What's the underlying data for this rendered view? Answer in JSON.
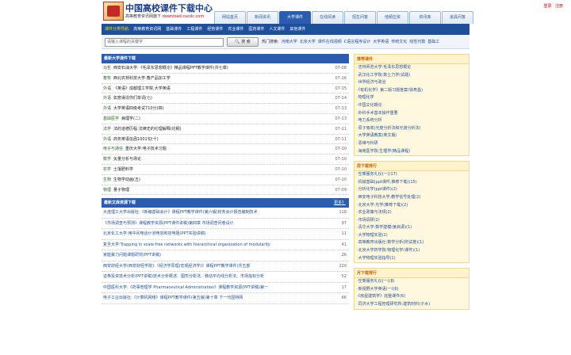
{
  "site": {
    "title": "中国高校课件下载中心",
    "subtitle": "高等教育资讯网旗下",
    "url": "download.cucdc.com"
  },
  "top_links": [
    "登录",
    "注册"
  ],
  "nav": {
    "tabs": [
      "网站首页",
      "新闻资讯",
      "大学课件",
      "在线阅读",
      "招生问答",
      "他频应资",
      "资讯库",
      "道具问答"
    ],
    "active_index": 2
  },
  "subnav": {
    "label": "课件分类导航:",
    "items": [
      "高等教育资讯网",
      "基础课件",
      "工程课件",
      "经管课件",
      "农业课件",
      "医药课件",
      "人文课件",
      "其他课件"
    ]
  },
  "search": {
    "placeholder": "请输入课程的关键字",
    "button": "搜 索",
    "hot_label": "热门搜索:",
    "hot_items": [
      "河南大学",
      "北京大学",
      "课件在线视频",
      "C语言程序设计",
      "大学英语",
      "传统文化",
      "线性代数",
      "基础工"
    ]
  },
  "course_section": {
    "title": "最新大学课件下载",
    "rows": [
      {
        "subject": "马哲",
        "title": "西安石油大学:《毛泽东思想概论》精品课程PPT教学课件(共七章)",
        "date": "07-08"
      },
      {
        "subject": "畜牧",
        "title": "西北农林科技大学:畜产品加工学",
        "date": "07-16"
      },
      {
        "subject": "外语",
        "title": "《英语》成都理工学院:大学英语",
        "date": "07-15"
      },
      {
        "subject": "外语",
        "title": "如意得逞你们单词(七)",
        "date": "07-14"
      },
      {
        "subject": "外语",
        "title": "大学英语四级考试710分(四)",
        "date": "07-13"
      },
      {
        "subject": "基础医学",
        "title": "病理学(二)",
        "date": "07-13"
      },
      {
        "subject": "法学",
        "title": "法的道德历程:法律史的伦理解释(论纲)",
        "date": "07-11"
      },
      {
        "subject": "外语",
        "title": "商务英语信函1001句(十)",
        "date": "07-11"
      },
      {
        "subject": "电子与通信",
        "title": "重庆大学:电子技术习题",
        "date": "07-10"
      },
      {
        "subject": "数学",
        "title": "矢量分析与场论",
        "date": "07-10"
      },
      {
        "subject": "农学",
        "title": "土壤肥料学",
        "date": "07-10"
      },
      {
        "subject": "生物",
        "title": "生物学动画(五)",
        "date": "07-10"
      },
      {
        "subject": "物理",
        "title": "量子物理",
        "date": "07-09"
      }
    ]
  },
  "library_section": {
    "title": "最新文库资源下载",
    "more": "更多》",
    "rows": [
      {
        "title": "大连理工大学出版社:《新编基础会计》课程PPT教学课件(第六版)财务会计报告编制技术",
        "count": "118"
      },
      {
        "title": "《市场调查与预测》课程教学资源(PPT课件讲稿)第四章 市场调查问卷设计",
        "count": "97"
      },
      {
        "title": "北京化工大学:用中间电话计测电容和容电阻(PPT实验讲稿)",
        "count": "11"
      },
      {
        "title": "复旦大学:Trapping in scale-free networks with hierarchical organization of modularity",
        "count": "41"
      },
      {
        "title": "家庭暴力问题课题研究(PPT讲稿)",
        "count": "26"
      },
      {
        "title": "西安财经大学(西安财经学院):《经济学原理(宏观经济学)》课程PPT教学课件(共五部",
        "count": "220"
      },
      {
        "title": "证券投资技术分析(PPT讲稿)技术分析概述、图形分析法、移动平均线分析法、市场指标分析",
        "count": "52"
      },
      {
        "title": "中国医科大学:《药事管理学 Pharmaceutical Administration》课程教学资源(PPT讲稿)第一",
        "count": "17"
      },
      {
        "title": "电子工业出版社:《计算机网络》课程PPT教学课件(第五版)第十章 下一代因特网",
        "count": "66"
      }
    ]
  },
  "side": [
    {
      "title": "推荐课件",
      "items": [
        "·吉林师范大学:毛泽东思想概论",
        "·武汉化工学院:数土力学(试题)",
        "·世界经济与政治",
        "·《有机化学》第二版习题答案(徐寿昌)",
        "·物理化学",
        "·中国文化概论",
        "·外科手术基本操作重要",
        "·电力系统分析",
        "·原子吸收(光度分析法和光谱分析法)",
        "·大学英语教案(英文版)",
        "·思维与科研",
        "·海南医学院:生理学(精品课程)"
      ]
    },
    {
      "title": "周下载排行",
      "items": [
        "·空乘服务礼仪(一)(17)",
        "·机械基础(ppt课件,推荐下载)(15)",
        "·分析化学(ppt课件)(2)",
        "·西安电子科技大学:教学信号处理(2)",
        "·北京大学:光学(推荐下载)(2)",
        "·农业政策与法规(2)",
        "·市场调研(2)",
        "·清华大学:数学建模(姜启源)(1)",
        "·大学物理实验(1)",
        "·高等教育出版社:数学分析(附试卷)(1)",
        "·北京大学药学院:物理化学(课件)(1)",
        "·大学物理实验指导(1)"
      ]
    },
    {
      "title": "月下载排行",
      "items": [
        "·空乘服务礼仪(一)(8)",
        "·新视野大学英语(一)(6)",
        "·《房屋建筑学》完整课件(6)",
        "·同济大学工程管理研究所:建筑材料(子水)"
      ]
    }
  ]
}
